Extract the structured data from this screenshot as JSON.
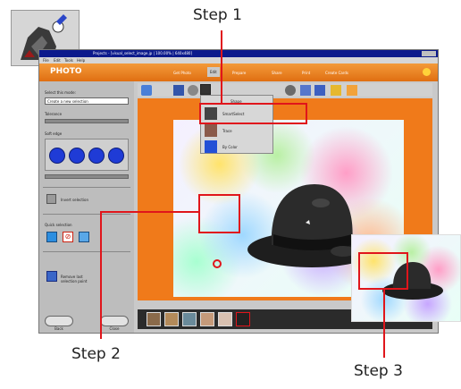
{
  "callouts": {
    "step1": "Step 1",
    "step2": "Step 2",
    "step3": "Step 3"
  },
  "window": {
    "title": "Projects - [visual_select_image.jp | 100.00% | 640x480]",
    "menu": [
      "File",
      "Edit",
      "Tools",
      "Help"
    ],
    "logo": "PHOTO",
    "nav_tabs": [
      "Get Photo",
      "Edit",
      "Prepare",
      "Share",
      "Print",
      "Create Cards"
    ]
  },
  "left_panel": {
    "select_label": "Select this mode:",
    "select_value": "Create a new selection",
    "tolerance_label": "Tolerance",
    "soft_edge_label": "Soft edge",
    "invert_label": "Invert selection",
    "quick_label": "Quick selection",
    "remove_label": "Remove last selection point",
    "back_button": "Back",
    "close_button": "Close"
  },
  "menu": {
    "header": "Shape",
    "items": [
      "SmartSelect",
      "Trace",
      "By Color"
    ]
  },
  "colors": {
    "accent_red": "#e0151b",
    "orange": "#f07a1a",
    "titlebar": "#0c1a8c"
  }
}
